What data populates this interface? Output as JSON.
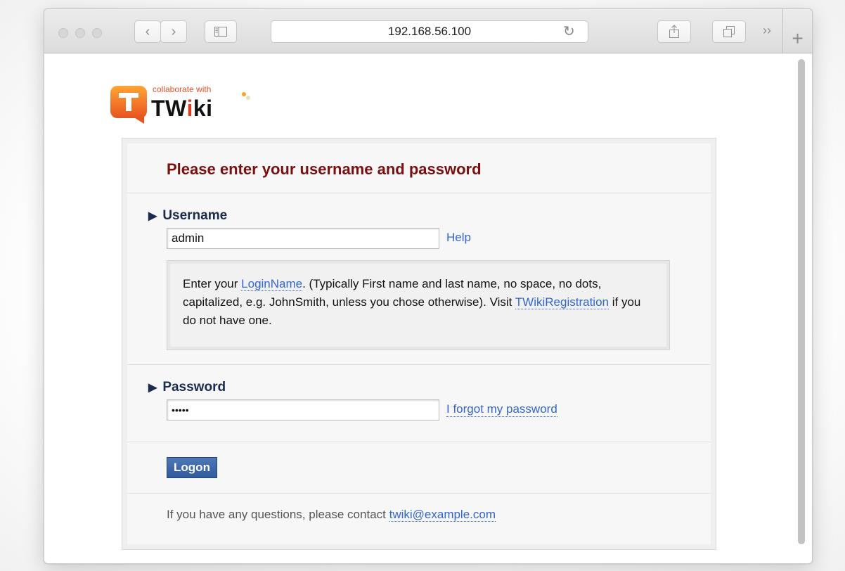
{
  "browser": {
    "address": "192.168.56.100",
    "back_icon": "‹",
    "forward_icon": "›",
    "sidebar_icon": "sidebar-icon",
    "reload_icon": "↻",
    "share_icon": "share-icon",
    "tabs_icon": "tabs-icon",
    "overflow_icon": "››",
    "newtab_icon": "+"
  },
  "logo": {
    "tagline": "collaborate with",
    "word_tw": "TW",
    "word_i": "i",
    "word_ki": "ki"
  },
  "login": {
    "heading": "Please enter your username and password",
    "username_label": "Username",
    "username_value": "admin",
    "help_link": "Help",
    "hint_prefix": "Enter your ",
    "hint_loginname": "LoginName",
    "hint_middle": ". (Typically First name and last name, no space, no dots, capitalized, e.g. JohnSmith, unless you chose otherwise). Visit ",
    "hint_registration": "TWikiRegistration",
    "hint_suffix": " if you do not have one.",
    "password_label": "Password",
    "password_value": "•••••",
    "forgot_link": "I forgot my password",
    "logon_button": "Logon",
    "contact_prefix": "If you have any questions, please contact ",
    "contact_email": "twiki@example.com"
  }
}
